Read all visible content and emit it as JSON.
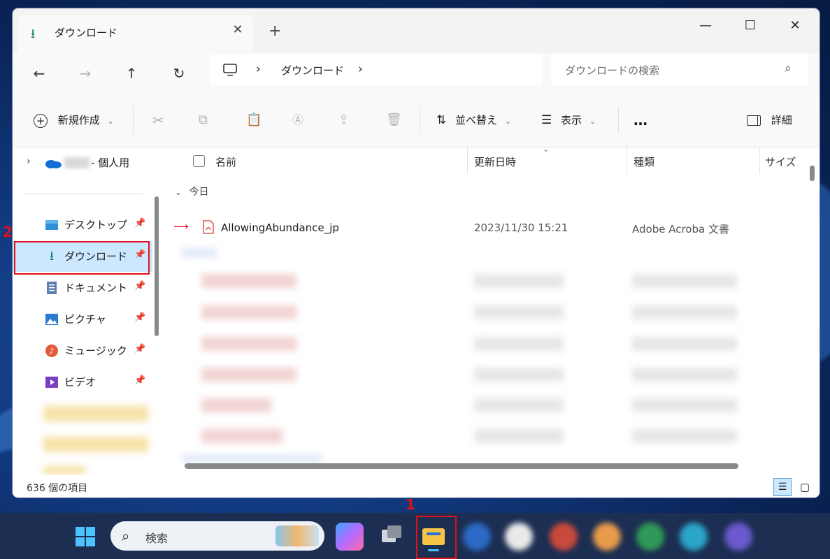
{
  "window": {
    "tab_title": "ダウンロード",
    "tab_close": "✕",
    "new_tab": "+",
    "minimize": "—",
    "maximize": "☐",
    "close": "✕"
  },
  "nav": {
    "back": "←",
    "forward": "→",
    "up": "↑",
    "refresh": "↻",
    "breadcrumb_sep": "›",
    "breadcrumb_current": "ダウンロード",
    "search_placeholder": "ダウンロードの検索",
    "search_icon": "⌕"
  },
  "toolbar": {
    "new_label": "新規作成",
    "sort_label": "並べ替え",
    "view_label": "表示",
    "more_label": "…",
    "details_label": "詳細"
  },
  "sidebar": {
    "onedrive_label": "- 個人用",
    "items": [
      {
        "label": "デスクトップ",
        "icon": "desktop-icon"
      },
      {
        "label": "ダウンロード",
        "icon": "download-icon"
      },
      {
        "label": "ドキュメント",
        "icon": "document-icon"
      },
      {
        "label": "ピクチャ",
        "icon": "picture-icon"
      },
      {
        "label": "ミュージック",
        "icon": "music-icon"
      },
      {
        "label": "ビデオ",
        "icon": "video-icon"
      }
    ]
  },
  "columns": {
    "name": "名前",
    "modified": "更新日時",
    "type": "種類",
    "size": "サイズ"
  },
  "groups": {
    "today": "今日"
  },
  "files": [
    {
      "name": "AllowingAbundance_jp",
      "modified": "2023/11/30 15:21",
      "type": "Adobe Acroba 文書"
    }
  ],
  "status": {
    "item_count": "636 個の項目"
  },
  "taskbar": {
    "search_label": "検索"
  },
  "annotations": {
    "step1": "1",
    "step2": "2"
  },
  "colors": {
    "accent_red": "#e0101a",
    "selection": "#cce8ff",
    "taskbar": "#1c2e52"
  }
}
